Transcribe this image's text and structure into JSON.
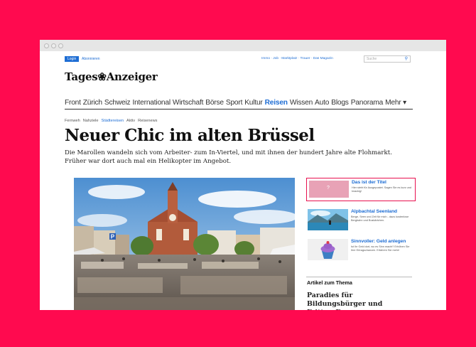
{
  "browser": {
    "dots": 3
  },
  "topbar": {
    "login": "Login",
    "abonnieren": "Abonnieren",
    "services": "Immo · Job · Marktplatz · Trauer · Das Magazin",
    "search_placeholder": "Suche"
  },
  "logo": {
    "text": "Tages❀Anzeiger"
  },
  "nav": {
    "items": [
      "Front",
      "Zürich",
      "Schweiz",
      "International",
      "Wirtschaft",
      "Börse",
      "Sport",
      "Kultur",
      "Reisen",
      "Wissen",
      "Auto",
      "Blogs",
      "Panorama",
      "Mehr ▾"
    ],
    "active": "Reisen"
  },
  "subnav": {
    "items": [
      "Fernweh",
      "Nahziele",
      "Städtereisen",
      "Aktiv",
      "Reisenews"
    ],
    "active": "Städtereisen"
  },
  "article": {
    "headline": "Neuer Chic im alten Brüssel",
    "lead": "Die Marollen wandeln sich vom Arbeiter- zum In-Viertel, und mit ihnen der hundert Jahre alte Flohmarkt. Früher war dort auch mal ein Helikopter im Angebot."
  },
  "sidebar": {
    "promo": {
      "title": "Das ist der Titel",
      "text": "Hier steht für Ausgepostet. Sagen Sie es kurz und knackig!",
      "thumb_label": "?"
    },
    "teasers": [
      {
        "title": "Alpbachtal Seenland",
        "text": "Berge, Seen und Zeit für mich - dazu kostenlose Bergbahn und Buskärtchen."
      },
      {
        "title": "Sinnvoller: Geld anlegen",
        "text": "Ist Ihr Geld dort, wo es Sinn macht? Erhöhen Sie Ihre Ertragschancen. Erfahren Sie mehr!"
      }
    ],
    "related_label": "Artikel zum Thema",
    "related_title": "Paradies für Bildungsbürger und Fritten-Esser"
  },
  "colors": {
    "background": "#ff0a4f",
    "link": "#1f6ed4",
    "promo_border": "#e8104f"
  }
}
